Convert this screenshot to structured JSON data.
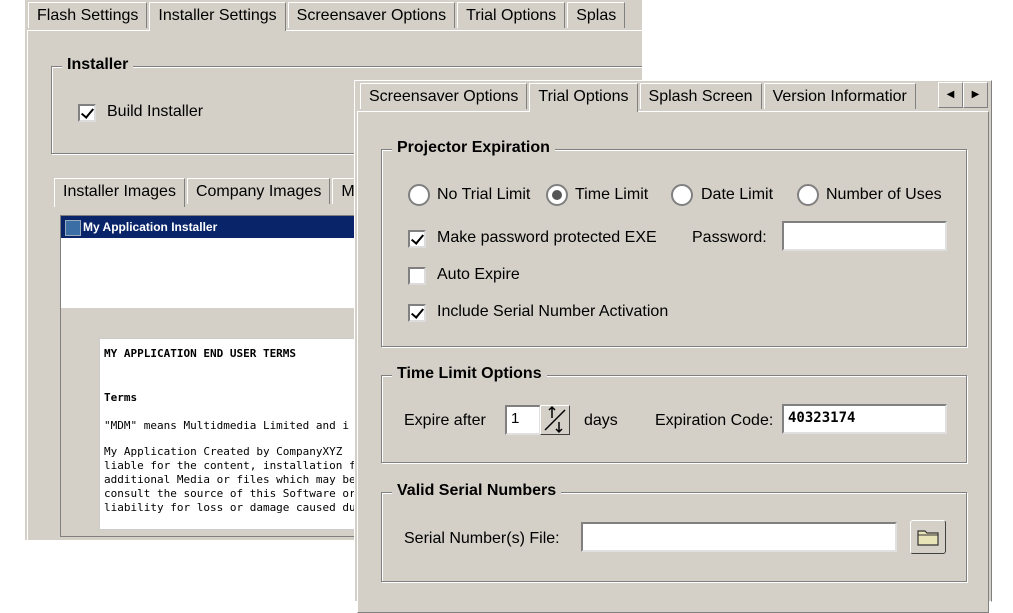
{
  "back_window": {
    "tabs": [
      "Flash Settings",
      "Installer Settings",
      "Screensaver Options",
      "Trial Options",
      "Splas"
    ],
    "installer_group": {
      "legend": "Installer",
      "build_installer_label": "Build Installer",
      "build_installer_checked": true
    },
    "sub_tabs": [
      "Installer Images",
      "Company Images",
      "M"
    ],
    "preview": {
      "title": "My Application Installer",
      "page_heading": "MY APPLICATION END USER TERMS",
      "terms_heading": "Terms",
      "line1": "\"MDM\" means Multidmedia Limited and i",
      "para": [
        "My Application Created by CompanyXYZ",
        "liable for the content, installation file, S",
        "additional Media or files which may be i",
        "consult the source of this Software or A",
        "liability for loss or damage caused due t"
      ]
    }
  },
  "front_window": {
    "tabs": [
      "Screensaver Options",
      "Trial Options",
      "Splash Screen",
      "Version Informatior"
    ],
    "active_tab": "Trial Options",
    "projector_expiration": {
      "legend": "Projector Expiration",
      "radios": [
        "No Trial Limit",
        "Time Limit",
        "Date Limit",
        "Number of Uses"
      ],
      "selected_radio": "Time Limit",
      "password_exe_label": "Make password protected EXE",
      "password_exe_checked": true,
      "password_label": "Password:",
      "password_value": "",
      "auto_expire_label": "Auto Expire",
      "auto_expire_checked": false,
      "serial_activation_label": "Include Serial Number Activation",
      "serial_activation_checked": true
    },
    "time_limit_options": {
      "legend": "Time Limit Options",
      "expire_after_label": "Expire after",
      "expire_after_value": "1",
      "days_label": "days",
      "expiration_code_label": "Expiration Code:",
      "expiration_code_value": "40323174"
    },
    "valid_serial_numbers": {
      "legend": "Valid Serial Numbers",
      "file_label": "Serial Number(s) File:",
      "file_value": ""
    }
  }
}
